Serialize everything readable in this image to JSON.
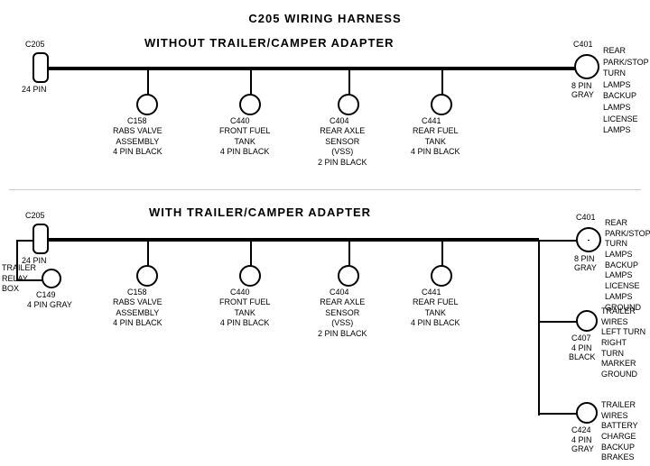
{
  "title": "C205 WIRING HARNESS",
  "section1": {
    "label": "WITHOUT  TRAILER/CAMPER  ADAPTER",
    "left_connector": {
      "id": "C205",
      "pins": "24 PIN"
    },
    "right_connector": {
      "id": "C401",
      "pins": "8 PIN",
      "color": "GRAY",
      "desc": "REAR PARK/STOP\nTURN LAMPS\nBACKUP LAMPS\nLICENSE LAMPS"
    },
    "connectors": [
      {
        "id": "C158",
        "desc": "RABS VALVE\nASSEMBLY\n4 PIN BLACK"
      },
      {
        "id": "C440",
        "desc": "FRONT FUEL\nTANK\n4 PIN BLACK"
      },
      {
        "id": "C404",
        "desc": "REAR AXLE\nSENSOR\n(VSS)\n2 PIN BLACK"
      },
      {
        "id": "C441",
        "desc": "REAR FUEL\nTANK\n4 PIN BLACK"
      }
    ]
  },
  "section2": {
    "label": "WITH  TRAILER/CAMPER  ADAPTER",
    "left_connector": {
      "id": "C205",
      "pins": "24 PIN"
    },
    "right_connector": {
      "id": "C401",
      "pins": "8 PIN",
      "color": "GRAY",
      "desc": "REAR PARK/STOP\nTURN LAMPS\nBACKUP LAMPS\nLICENSE LAMPS\nGROUND"
    },
    "connectors": [
      {
        "id": "C158",
        "desc": "RABS VALVE\nASSEMBLY\n4 PIN BLACK"
      },
      {
        "id": "C440",
        "desc": "FRONT FUEL\nTANK\n4 PIN BLACK"
      },
      {
        "id": "C404",
        "desc": "REAR AXLE\nSENSOR\n(VSS)\n2 PIN BLACK"
      },
      {
        "id": "C441",
        "desc": "REAR FUEL\nTANK\n4 PIN BLACK"
      }
    ],
    "extra_left": {
      "label": "TRAILER\nRELAY\nBOX",
      "connector_id": "C149",
      "connector_desc": "4 PIN GRAY"
    },
    "extra_right1": {
      "id": "C407",
      "pins": "4 PIN",
      "color": "BLACK",
      "desc": "TRAILER WIRES\nLEFT TURN\nRIGHT TURN\nMARKER\nGROUND"
    },
    "extra_right2": {
      "id": "C424",
      "pins": "4 PIN",
      "color": "GRAY",
      "desc": "TRAILER WIRES\nBATTERY CHARGE\nBACKUP\nBRAKES"
    }
  }
}
